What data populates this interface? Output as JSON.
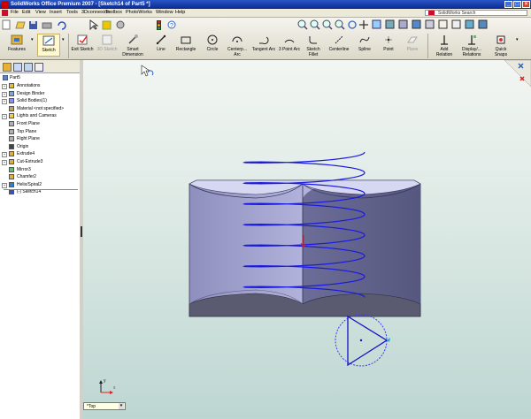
{
  "window": {
    "title": "SolidWorks Office Premium 2007 - [Sketch14 of Part5 *]",
    "buttons": [
      "_",
      "□",
      "×"
    ]
  },
  "menubar": {
    "items": [
      "File",
      "Edit",
      "View",
      "Insert",
      "Tools",
      "3Dconnexion",
      "Toolbox",
      "PhotoWorks",
      "Window",
      "Help"
    ],
    "search_placeholder": "SolidWorks Search"
  },
  "command_manager": {
    "tabs": [
      "Features",
      "Sketch"
    ],
    "sketch_commands": [
      "Exit Sketch",
      "3D Sketch",
      "Smart Dimension",
      "Line",
      "Rectangle",
      "Circle",
      "Centerp... Arc",
      "Tangent Arc",
      "3 Point Arc",
      "Sketch Fillet",
      "Centerline",
      "Spline",
      "Point",
      "Plane"
    ],
    "relation_commands": [
      "Add Relation",
      "Display/... Relations",
      "Quick Snaps"
    ]
  },
  "feature_tree": {
    "root": "Part5",
    "items": [
      {
        "label": "Annotations",
        "expandable": true
      },
      {
        "label": "Design Binder",
        "expandable": true
      },
      {
        "label": "Solid Bodies(1)",
        "expandable": true
      },
      {
        "label": "Material <not specified>",
        "expandable": false
      },
      {
        "label": "Lights and Cameras",
        "expandable": true
      },
      {
        "label": "Front Plane",
        "expandable": false
      },
      {
        "label": "Top Plane",
        "expandable": false
      },
      {
        "label": "Right Plane",
        "expandable": false
      },
      {
        "label": "Origin",
        "expandable": false
      },
      {
        "label": "Extrude4",
        "expandable": true
      },
      {
        "label": "Cut-Extrude3",
        "expandable": true
      },
      {
        "label": "Mirror3",
        "expandable": false
      },
      {
        "label": "Chamfer2",
        "expandable": false
      },
      {
        "label": "Helix/Spiral2",
        "expandable": true
      },
      {
        "label": "(-) Sketch14",
        "expandable": false
      }
    ]
  },
  "viewport": {
    "view_orientation": "*Top",
    "triad_labels": {
      "x": "x",
      "y": "y"
    }
  },
  "colors": {
    "helix": "#1a1ae0",
    "nut_light": "#a7a8d4",
    "nut_dark": "#5d5e86",
    "sketch_selected": "#3a3aff"
  }
}
